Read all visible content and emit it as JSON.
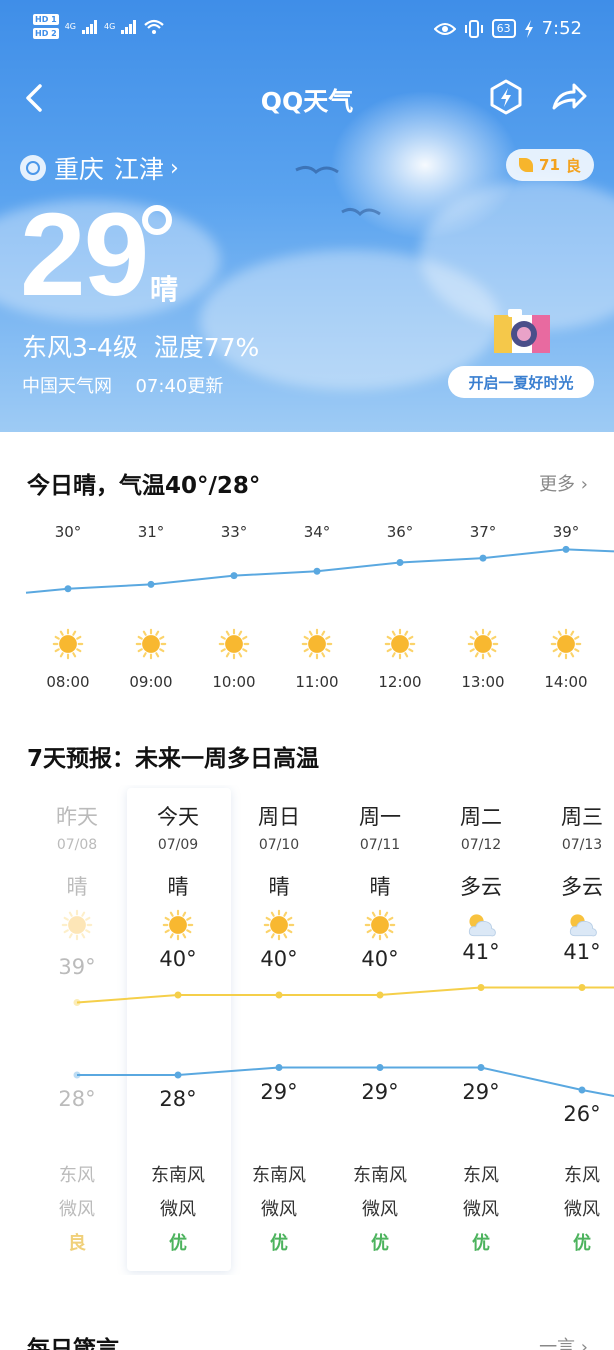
{
  "status_bar": {
    "sim1": "HD 1",
    "sim2": "HD 2",
    "net1": "4G",
    "net2": "4G",
    "battery": "63",
    "time": "7:52"
  },
  "app": {
    "title": "QQ天气"
  },
  "location": {
    "city": "重庆",
    "district": "江津"
  },
  "aqi_badge": {
    "value": "71",
    "level": "良"
  },
  "current": {
    "temp": "29",
    "condition": "晴",
    "wind_humidity": "东风3-4级  湿度77%",
    "source": "中国天气网",
    "updated": "07:40更新"
  },
  "promo": {
    "label": "开启一夏好时光"
  },
  "today": {
    "summary": "今日晴，气温40°/28°",
    "more_label": "更多"
  },
  "hourly": [
    {
      "temp": "30°",
      "time": "08:00",
      "icon": "sun-icon"
    },
    {
      "temp": "31°",
      "time": "09:00",
      "icon": "sun-icon"
    },
    {
      "temp": "33°",
      "time": "10:00",
      "icon": "sun-icon"
    },
    {
      "temp": "34°",
      "time": "11:00",
      "icon": "sun-icon"
    },
    {
      "temp": "36°",
      "time": "12:00",
      "icon": "sun-icon"
    },
    {
      "temp": "37°",
      "time": "13:00",
      "icon": "sun-icon"
    },
    {
      "temp": "39°",
      "time": "14:00",
      "icon": "sun-icon"
    }
  ],
  "forecast": {
    "title": "7天预报：未来一周多日高温",
    "days": [
      {
        "name": "昨天",
        "date": "07/08",
        "weather": "晴",
        "icon": "sun-icon",
        "hi": "39°",
        "lo": "28°",
        "wind_dir": "东风",
        "wind_level": "微风",
        "aqi": "良",
        "past": true
      },
      {
        "name": "今天",
        "date": "07/09",
        "weather": "晴",
        "icon": "sun-icon",
        "hi": "40°",
        "lo": "28°",
        "wind_dir": "东南风",
        "wind_level": "微风",
        "aqi": "优",
        "past": false
      },
      {
        "name": "周日",
        "date": "07/10",
        "weather": "晴",
        "icon": "sun-icon",
        "hi": "40°",
        "lo": "29°",
        "wind_dir": "东南风",
        "wind_level": "微风",
        "aqi": "优",
        "past": false
      },
      {
        "name": "周一",
        "date": "07/11",
        "weather": "晴",
        "icon": "sun-icon",
        "hi": "40°",
        "lo": "29°",
        "wind_dir": "东南风",
        "wind_level": "微风",
        "aqi": "优",
        "past": false
      },
      {
        "name": "周二",
        "date": "07/12",
        "weather": "多云",
        "icon": "partly-cloudy-icon",
        "hi": "41°",
        "lo": "29°",
        "wind_dir": "东风",
        "wind_level": "微风",
        "aqi": "优",
        "past": false
      },
      {
        "name": "周三",
        "date": "07/13",
        "weather": "多云",
        "icon": "partly-cloudy-icon",
        "hi": "41°",
        "lo": "26°",
        "wind_dir": "东风",
        "wind_level": "微风",
        "aqi": "优",
        "past": false
      }
    ]
  },
  "next_section": {
    "title": "每日箴言",
    "more_label": "一言"
  },
  "colors": {
    "sky_top": "#3f8ee8",
    "hourly_line": "#5aa8e0",
    "hi_line": "#f5cf4a",
    "lo_line": "#5aa8e0",
    "aqi_good": "#4db35e",
    "aqi_moderate": "#f0d07a",
    "sun": "#f8b830"
  }
}
